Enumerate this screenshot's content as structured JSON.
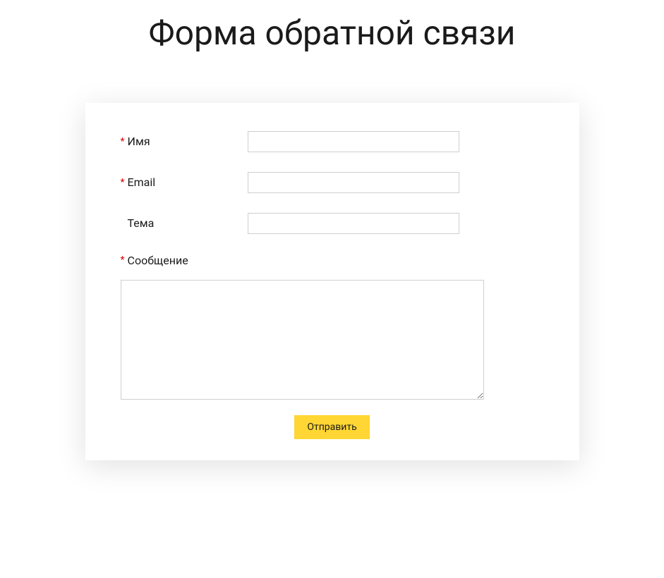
{
  "page": {
    "title": "Форма обратной связи"
  },
  "form": {
    "fields": {
      "name": {
        "label": "Имя",
        "required_marker": "*",
        "value": ""
      },
      "email": {
        "label": "Email",
        "required_marker": "*",
        "value": ""
      },
      "subject": {
        "label": "Тема",
        "value": ""
      },
      "message": {
        "label": "Сообщение",
        "required_marker": "*",
        "value": ""
      }
    },
    "submit_label": "Отправить"
  }
}
